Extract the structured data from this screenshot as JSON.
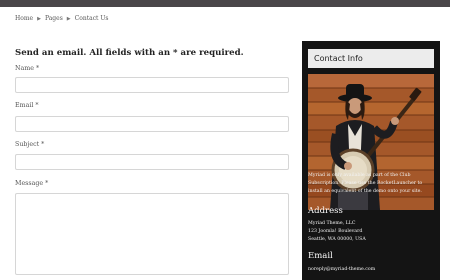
{
  "breadcrumb": {
    "home": "Home",
    "pages": "Pages",
    "current": "Contact Us"
  },
  "form": {
    "title": "Send an email. All fields with an * are required.",
    "name_label": "Name *",
    "email_label": "Email *",
    "subject_label": "Subject *",
    "message_label": "Message *",
    "name_value": "",
    "email_value": "",
    "subject_value": "",
    "message_value": ""
  },
  "sidebar": {
    "title": "Contact Info",
    "promo_line1": "Myriad is only available as part of the Club",
    "promo_line2": "Subscription. Please use the RocketLauncher to",
    "promo_line3": "install an equivalent of the demo onto your site.",
    "address_heading": "Address",
    "address_line1": "Myriad Theme, LLC",
    "address_line2": "123 Joomla! Boulevard",
    "address_line3": "Seattle, WA 00000, USA",
    "email_heading": "Email",
    "email_value": "noreply@myriad-theme.com"
  },
  "colors": {
    "topbar": "#4a4649",
    "sidebar_bg": "#141414",
    "sidebar_header_bg": "#ececec"
  },
  "icons": {
    "breadcrumb_separator": "triangle-right"
  }
}
